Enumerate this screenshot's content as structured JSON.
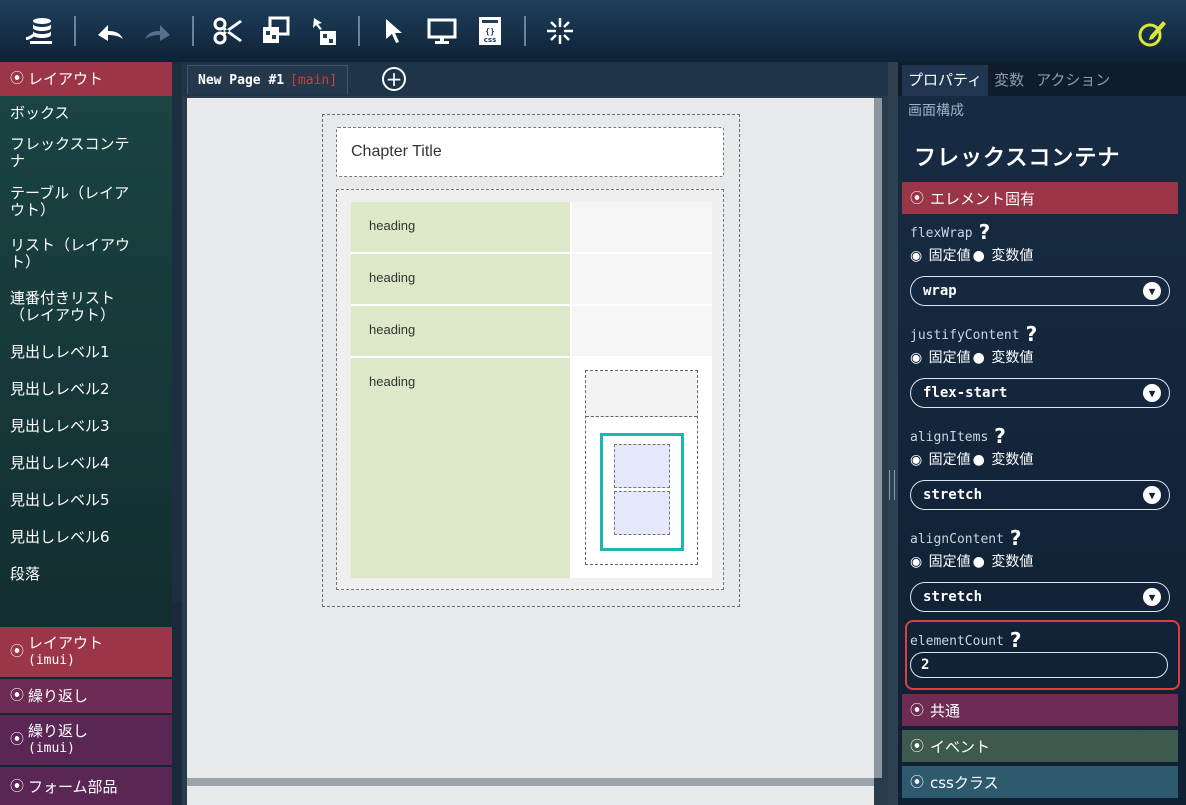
{
  "toolbar": {
    "icons": [
      "database-icon",
      "undo-icon",
      "redo-icon",
      "cut-icon",
      "copy-element-icon",
      "move-element-icon",
      "select-arrow-icon",
      "preview-monitor-icon",
      "css-file-icon",
      "sparkle-icon",
      "edit-pencil-icon"
    ],
    "css_label": "css"
  },
  "palette": {
    "layout_header": "レイアウト",
    "items": [
      "ボックス",
      "フレックスコンテナ",
      "テーブル（レイアウト）",
      "リスト（レイアウト）",
      "連番付きリスト（レイアウト）",
      "見出しレベル1",
      "見出しレベル2",
      "見出しレベル3",
      "見出しレベル4",
      "見出しレベル5",
      "見出しレベル6",
      "段落"
    ],
    "item_lines": [
      [
        "ボックス"
      ],
      [
        "フレックスコンテ",
        "ナ"
      ],
      [
        "テーブル（レイア",
        "ウト）"
      ],
      [
        "リスト（レイアウ",
        "ト）"
      ],
      [
        "連番付きリスト",
        "（レイアウト）"
      ],
      [
        "見出しレベル1"
      ],
      [
        "見出しレベル2"
      ],
      [
        "見出しレベル3"
      ],
      [
        "見出しレベル4"
      ],
      [
        "見出しレベル5"
      ],
      [
        "見出しレベル6"
      ],
      [
        "段落"
      ]
    ],
    "groups": [
      {
        "label": "レイアウト",
        "sub": "(imui)"
      },
      {
        "label": "繰り返し",
        "sub": ""
      },
      {
        "label": "繰り返し",
        "sub": "(imui)"
      },
      {
        "label": "フォーム部品",
        "sub": ""
      }
    ]
  },
  "editor": {
    "tab_label": "New Page #1",
    "tab_branch": "[main]",
    "add_tab": "+",
    "chapter_title": "Chapter Title",
    "headings": [
      "heading",
      "heading",
      "heading",
      "heading"
    ]
  },
  "properties": {
    "tabs": [
      "プロパティ",
      "変数",
      "アクション"
    ],
    "subtitle": "画面構成",
    "component_title": "フレックスコンテナ",
    "section_specific": "エレメント固有",
    "radio_fixed": "固定値",
    "radio_var": "変数値",
    "help": "?",
    "props": [
      {
        "name": "flexWrap",
        "value": "wrap"
      },
      {
        "name": "justifyContent",
        "value": "flex-start"
      },
      {
        "name": "alignItems",
        "value": "stretch"
      },
      {
        "name": "alignContent",
        "value": "stretch"
      }
    ],
    "element_count": {
      "name": "elementCount",
      "value": "2"
    },
    "sections": [
      "共通",
      "イベント",
      "cssクラス"
    ],
    "colors": {
      "specific": "#9b3548",
      "common": "#6e2c55",
      "event": "#3e5a4e",
      "css": "#2e5a6e"
    }
  }
}
